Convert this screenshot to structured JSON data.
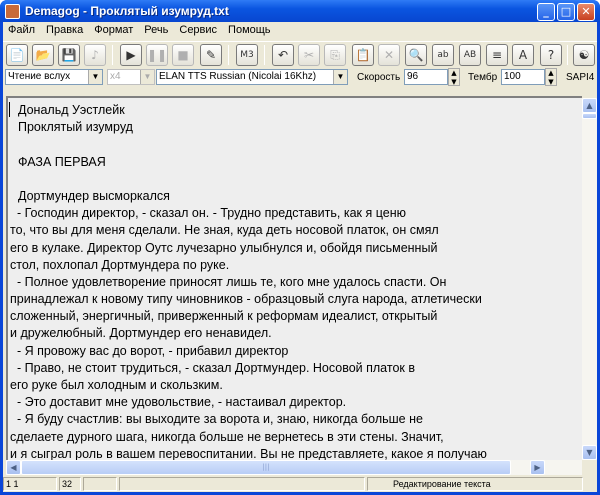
{
  "window": {
    "app": "Demagog",
    "title": "Demagog - Проклятый изумруд.txt",
    "min": "_",
    "max": "□",
    "close": "✕"
  },
  "menu": [
    "Файл",
    "Правка",
    "Формат",
    "Речь",
    "Сервис",
    "Помощь"
  ],
  "toolbar": {
    "new": "📄",
    "open": "📂",
    "save": "💾",
    "note": "♪",
    "play": "▶",
    "pause": "❚❚",
    "stop": "■",
    "erase": "✎",
    "mp3": "M3",
    "undo": "↶",
    "cut": "✂",
    "copy": "⎘",
    "paste": "📋",
    "delete": "✕",
    "find": "🔍",
    "replace": "ab",
    "replace2": "AB",
    "align": "≡",
    "font": "A",
    "help": "?",
    "sapi": "☯"
  },
  "controls": {
    "mode": "Чтение вслух",
    "multiplier": "x4",
    "voice": "ELAN TTS Russian (Nicolai 16Khz)",
    "speed_label": "Скорость",
    "speed": "96",
    "timbre_label": "Тембр",
    "timbre": "100",
    "sapi": "SAPI4"
  },
  "text": [
    "Дональд Уэстлейк",
    "Проклятый изумруд",
    "",
    "ФАЗА ПЕРВАЯ",
    "",
    "Дортмундер высморкался",
    "  - Господин директор, - сказал он. - Трудно представить, как я ценю",
    "то, что вы для меня сделали. Не зная, куда деть носовой платок, он смял",
    "его в кулаке. Директор Оутс лучезарно улыбнулся и, обойдя письменный",
    "стол, похлопал Дортмундера по руке.",
    "  - Полное удовлетворение приносят лишь те, кого мне удалось спасти. Он",
    "принадлежал к новому типу чиновников - образцовый слуга народа, атлетически",
    "сложенный, энергичный, приверженный к реформам идеалист, открытый",
    "и дружелюбный. Дортмундер его ненавидел.",
    "  - Я провожу вас до ворот, - прибавил директор",
    "  - Право, не стоит трудиться, - сказал Дортмундер. Носовой платок в",
    "его руке был холодным и скользким.",
    "  - Это доставит мне удовольствие, - настаивал директор.",
    "  - Я буду счастлив: вы выходите за ворота и, знаю, никогда больше не",
    "сделаете дурного шага, никогда больше не вернетесь в эти стены. Значит,",
    "и я сыграл роль в вашем перевоспитании. Вы не представляете, какое я получаю"
  ],
  "status": {
    "position": "1  1",
    "count": "32",
    "extra": "",
    "mode": "Редактирование текста"
  }
}
